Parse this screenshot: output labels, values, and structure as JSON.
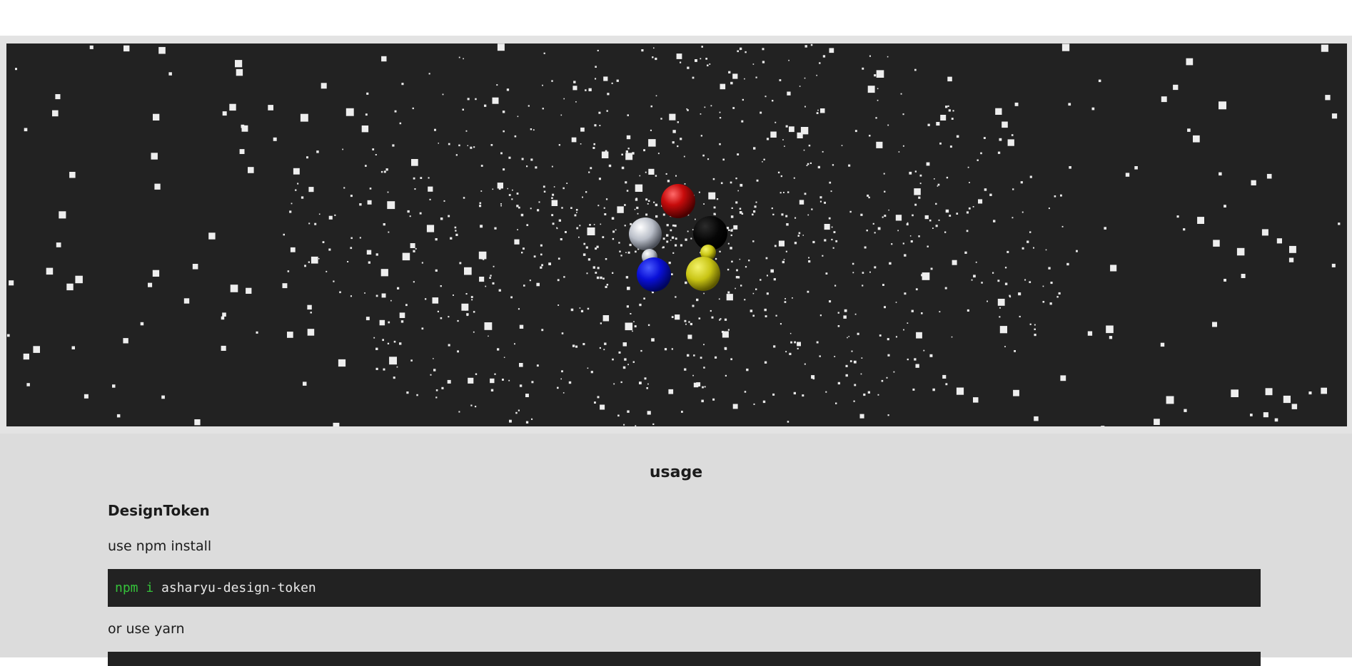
{
  "usage": {
    "title": "usage",
    "design_token": {
      "heading": "DesignToken",
      "npm_text": "use npm install",
      "npm_code": {
        "cmd": "npm i",
        "arg": "asharyu-design-token"
      },
      "yarn_text": "or use yarn"
    }
  },
  "colors": {
    "page_bg": "#ffffff",
    "hero_bg": "#222222",
    "content_bg": "#dcdcdc",
    "code_bg": "#222222",
    "code_command": "#35c23a",
    "code_text": "#e8e8e8"
  },
  "hero": {
    "spheres": [
      "red",
      "white",
      "black",
      "blue",
      "yellow"
    ]
  }
}
